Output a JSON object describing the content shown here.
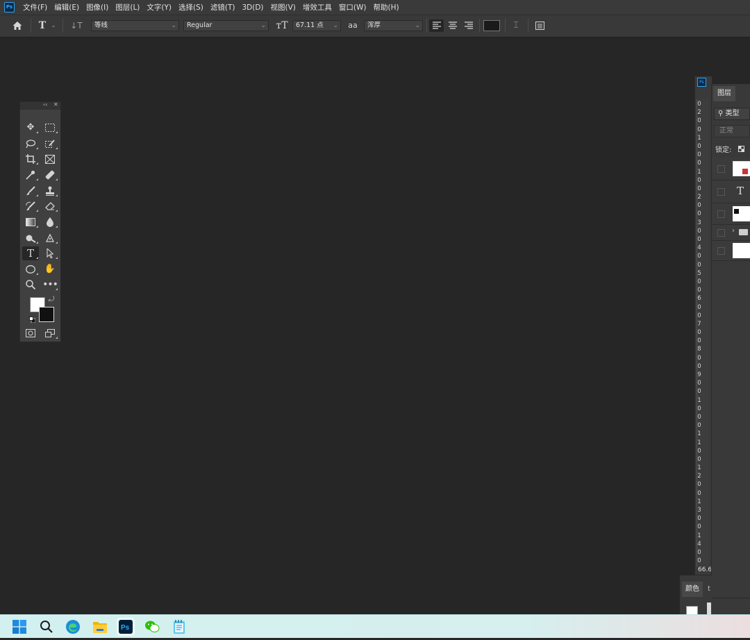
{
  "app": {
    "logo_text": "Ps"
  },
  "menu": [
    "文件(F)",
    "编辑(E)",
    "图像(I)",
    "图层(L)",
    "文字(Y)",
    "选择(S)",
    "滤镜(T)",
    "3D(D)",
    "视图(V)",
    "增效工具",
    "窗口(W)",
    "帮助(H)"
  ],
  "options_bar": {
    "font_family": "等线",
    "font_style": "Regular",
    "font_size": "67.11 点",
    "aa_icon": "aa",
    "anti_alias": "浑厚",
    "text_color": "#1a1a1a"
  },
  "tools_panel": {
    "collapse": "‹‹",
    "close": "✕",
    "foreground_color": "#ffffff",
    "background_color": "#111111"
  },
  "ruler": {
    "labels": [
      "0",
      "2",
      "0",
      "0",
      "1",
      "0",
      "0",
      "0",
      "1",
      "0",
      "0",
      "2",
      "0",
      "0",
      "3",
      "0",
      "0",
      "4",
      "0",
      "0",
      "5",
      "0",
      "0",
      "6",
      "0",
      "0",
      "7",
      "0",
      "0",
      "8",
      "0",
      "0",
      "9",
      "0",
      "0",
      "1",
      "0",
      "0",
      "0",
      "1",
      "1",
      "0",
      "0",
      "1",
      "2",
      "0",
      "0",
      "1",
      "3",
      "0",
      "0",
      "1",
      "4",
      "0",
      "0"
    ],
    "zoom": "66.6"
  },
  "layers_panel": {
    "tab": "图层",
    "filter": "类型",
    "blend_mode": "正常",
    "lock_label": "锁定:"
  },
  "color_panel": {
    "tab": "颜色",
    "tab2": "t"
  },
  "taskbar": [
    "start",
    "search",
    "edge",
    "explorer",
    "photoshop",
    "wechat",
    "notepad"
  ]
}
